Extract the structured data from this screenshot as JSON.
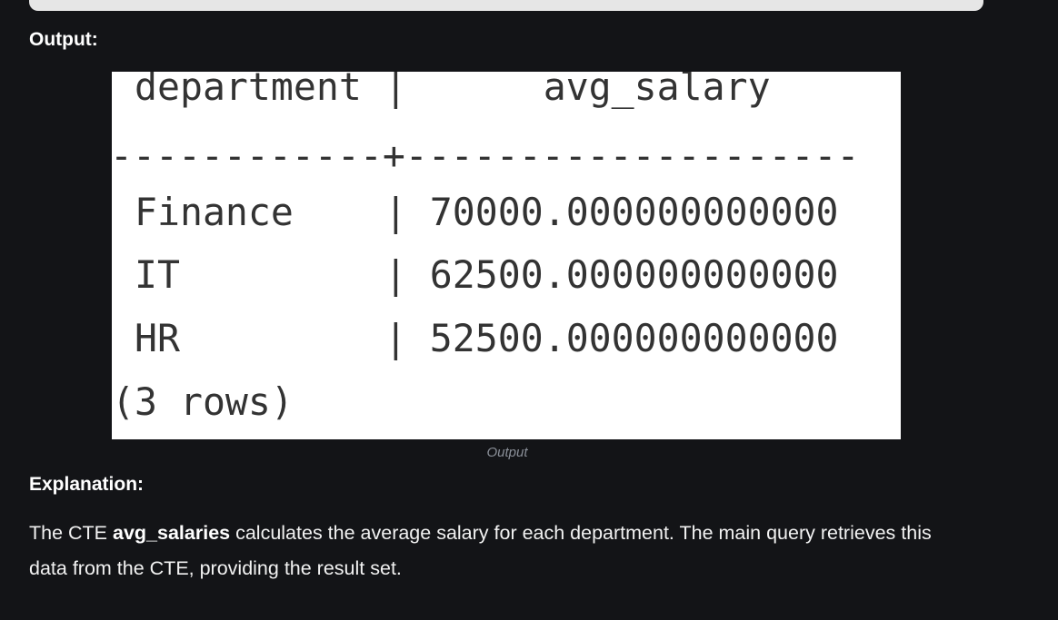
{
  "output_heading": "Output:",
  "output_table": {
    "header_line": " department |      avg_salary",
    "separator_line": "------------+--------------------",
    "rows": [
      " Finance    | 70000.000000000000",
      " IT         | 62500.000000000000",
      " HR         | 52500.000000000000"
    ],
    "footer_line": "(3 rows)",
    "columns": [
      "department",
      "avg_salary"
    ],
    "data": [
      {
        "department": "Finance",
        "avg_salary": "70000.000000000000"
      },
      {
        "department": "IT",
        "avg_salary": "62500.000000000000"
      },
      {
        "department": "HR",
        "avg_salary": "52500.000000000000"
      }
    ]
  },
  "caption": "Output",
  "explanation_heading": "Explanation:",
  "explanation": {
    "prefix": "The CTE ",
    "bold": "avg_salaries",
    "suffix": " calculates the average salary for each department. The main query retrieves this data from the CTE, providing the result set."
  }
}
